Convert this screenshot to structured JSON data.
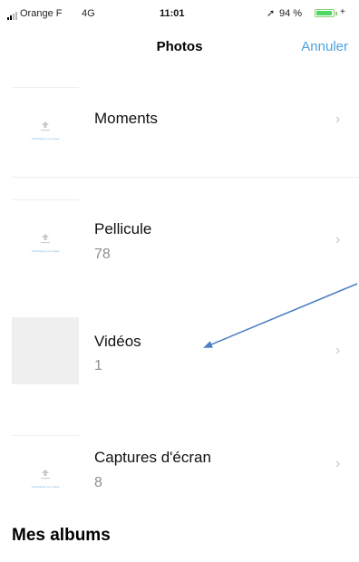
{
  "status_bar": {
    "carrier": "Orange F",
    "network": "4G",
    "time": "11:01",
    "location_glyph": "➚",
    "battery_percent": "94 %",
    "battery_level": 0.94,
    "charging_glyph": "+"
  },
  "nav": {
    "title": "Photos",
    "cancel_label": "Annuler"
  },
  "albums": [
    {
      "name": "Moments",
      "count": "",
      "thumbnail": "upload-placeholder-icon",
      "thumb_caption": "Télécharger une image"
    },
    {
      "name": "Pellicule",
      "count": "78",
      "thumbnail": "upload-placeholder-icon",
      "thumb_caption": "Télécharger une image"
    },
    {
      "name": "Vidéos",
      "count": "1",
      "thumbnail": "empty-thumbnail",
      "thumb_caption": ""
    },
    {
      "name": "Captures d'écran",
      "count": "8",
      "thumbnail": "upload-placeholder-icon",
      "thumb_caption": "Télécharger une image"
    }
  ],
  "section": {
    "my_albums_title": "Mes albums"
  },
  "chevron_glyph": "›",
  "colors": {
    "accent": "#4aa3e0",
    "annotation_arrow": "#4a7fc1",
    "battery": "#4cd964",
    "secondary_text": "#8e8e93"
  }
}
